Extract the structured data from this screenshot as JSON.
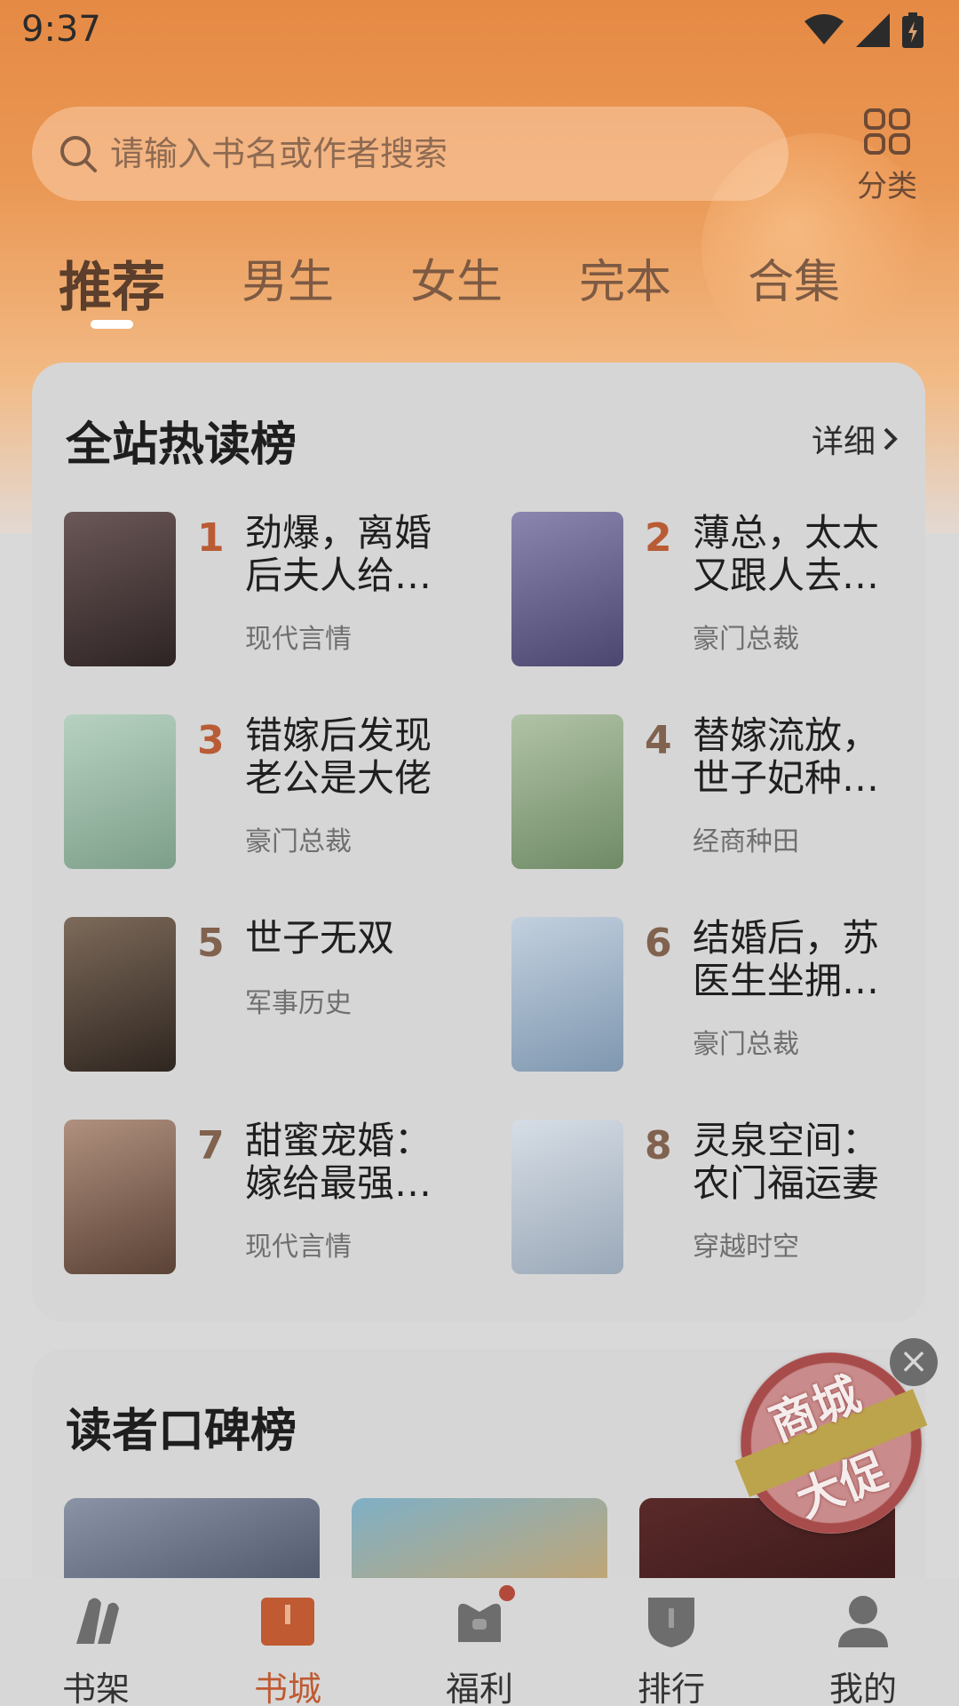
{
  "status_bar": {
    "time": "9:37"
  },
  "search": {
    "placeholder": "请输入书名或作者搜索"
  },
  "category": {
    "label": "分类"
  },
  "tabs": [
    {
      "label": "推荐",
      "active": true
    },
    {
      "label": "男生",
      "active": false
    },
    {
      "label": "女生",
      "active": false
    },
    {
      "label": "完本",
      "active": false
    },
    {
      "label": "合集",
      "active": false
    }
  ],
  "hot_list": {
    "title": "全站热读榜",
    "more_label": "详细",
    "books": [
      {
        "rank": "1",
        "title": "劲爆，离婚后夫人给…",
        "genre": "现代言情",
        "cover_color": "#4a3a3a"
      },
      {
        "rank": "2",
        "title": "薄总，太太又跟人去…",
        "genre": "豪门总裁",
        "cover_color": "#6a6690"
      },
      {
        "rank": "3",
        "title": "错嫁后发现老公是大佬",
        "genre": "豪门总裁",
        "cover_color": "#9bb9a6"
      },
      {
        "rank": "4",
        "title": "替嫁流放，世子妃种…",
        "genre": "经商种田",
        "cover_color": "#8fa58c"
      },
      {
        "rank": "5",
        "title": "世子无双",
        "genre": "军事历史",
        "cover_color": "#5a4a3e"
      },
      {
        "rank": "6",
        "title": "结婚后，苏医生坐拥…",
        "genre": "豪门总裁",
        "cover_color": "#9fb2c6"
      },
      {
        "rank": "7",
        "title": "甜蜜宠婚：嫁给最强…",
        "genre": "现代言情",
        "cover_color": "#8a6a5a"
      },
      {
        "rank": "8",
        "title": "灵泉空间：农门福运妻",
        "genre": "穿越时空",
        "cover_color": "#b9c3cf"
      }
    ]
  },
  "reader_list": {
    "title": "读者口碑榜"
  },
  "promo": {
    "line1": "商城",
    "line2": "大促"
  },
  "bottom_nav": [
    {
      "label": "书架",
      "active": false
    },
    {
      "label": "书城",
      "active": true
    },
    {
      "label": "福利",
      "active": false
    },
    {
      "label": "排行",
      "active": false
    },
    {
      "label": "我的",
      "active": false
    }
  ],
  "colors": {
    "accent": "#bf5a33",
    "header": "#e58a45"
  }
}
